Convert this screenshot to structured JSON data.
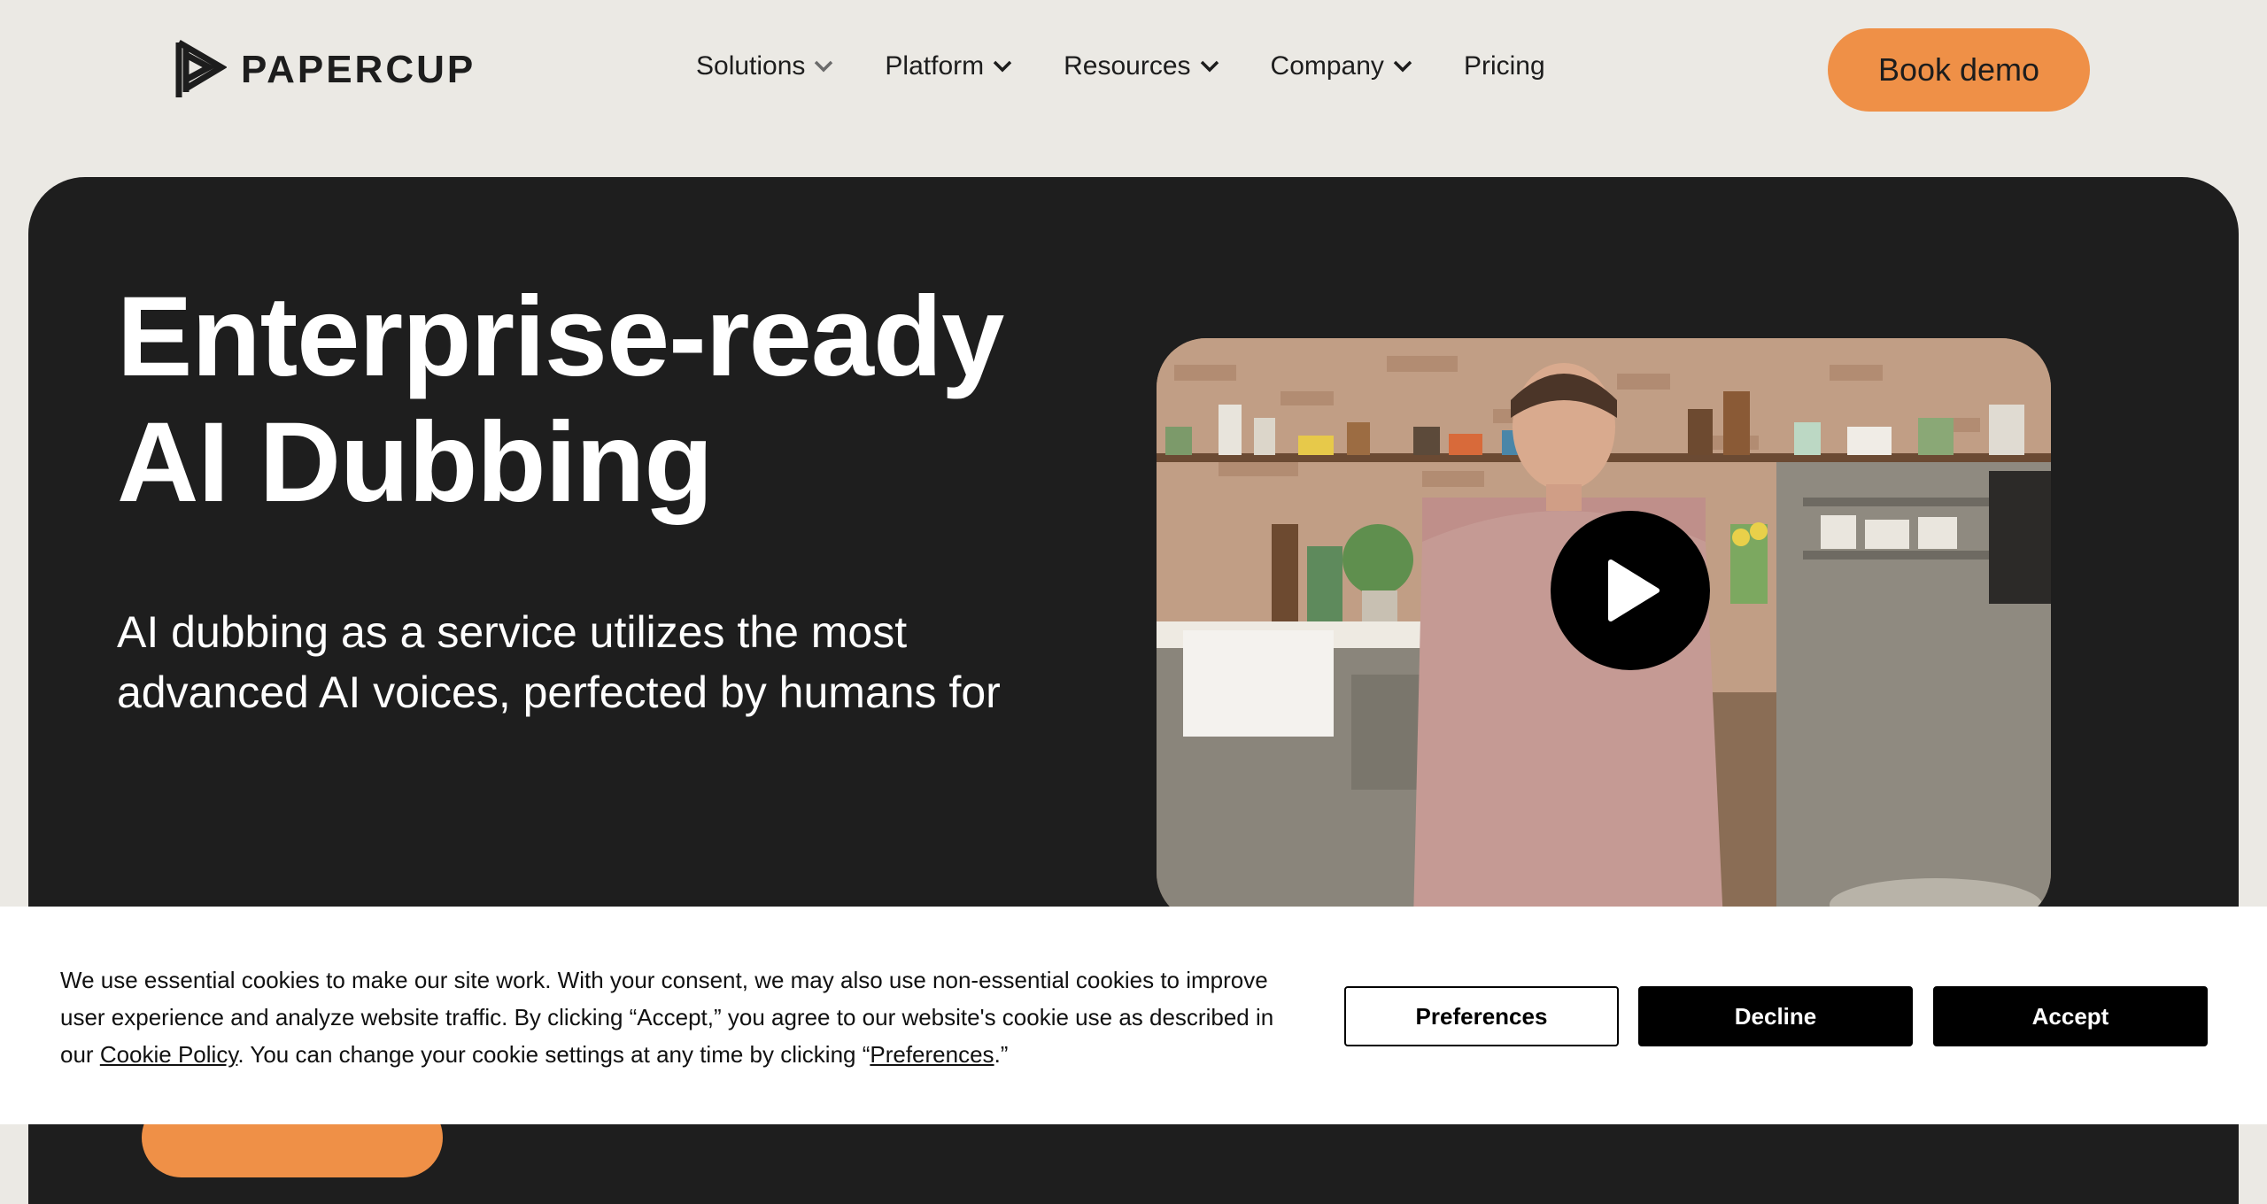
{
  "brand": {
    "name": "PAPERCUP",
    "accent": "#ef9047",
    "dark": "#1e1e1e",
    "page_bg": "#ebe9e4"
  },
  "nav": {
    "items": [
      {
        "label": "Solutions",
        "has_dropdown": true
      },
      {
        "label": "Platform",
        "has_dropdown": true
      },
      {
        "label": "Resources",
        "has_dropdown": true
      },
      {
        "label": "Company",
        "has_dropdown": true
      },
      {
        "label": "Pricing",
        "has_dropdown": false
      }
    ],
    "cta_label": "Book demo"
  },
  "hero": {
    "title_line1": "Enterprise-ready",
    "title_line2": "AI Dubbing",
    "subtitle": "AI dubbing as a service utilizes the most advanced AI voices, perfected by humans for"
  },
  "video": {
    "play_icon": "play-icon"
  },
  "cookie_banner": {
    "text_part1": "We use essential cookies to make our site work. With your consent, we may also use non-essential cookies to improve user experience and analyze website traffic. By clicking “Accept,” you agree to our website's cookie use as described in our ",
    "cookie_policy_link": "Cookie Policy",
    "text_part2": ". You can change your cookie settings at any time by clicking “",
    "preferences_link": "Preferences",
    "text_part3": ".”",
    "preferences_button": "Preferences",
    "decline_button": "Decline",
    "accept_button": "Accept"
  }
}
